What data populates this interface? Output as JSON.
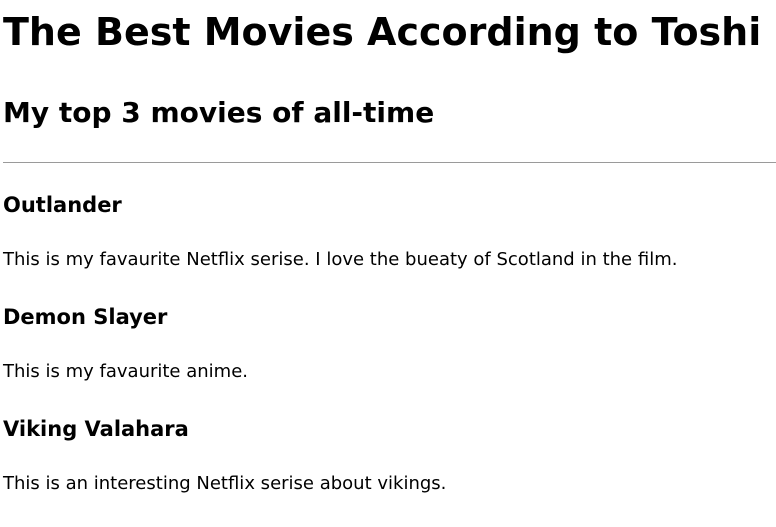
{
  "page": {
    "title": "The Best Movies According to Toshi",
    "subtitle": "My top 3 movies of all-time"
  },
  "movies": [
    {
      "title": "Outlander",
      "description": "This is my favaurite Netflix serise. I love the bueaty of Scotland in the film."
    },
    {
      "title": "Demon Slayer",
      "description": "This is my favaurite anime."
    },
    {
      "title": "Viking Valahara",
      "description": "This is an interesting Netflix serise about vikings."
    }
  ]
}
